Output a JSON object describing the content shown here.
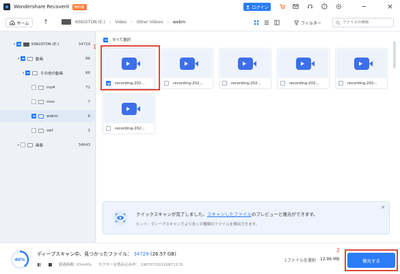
{
  "titlebar": {
    "app_name": "Wondershare Recoverit",
    "badge": "無料版",
    "login_label": "ログイン"
  },
  "toolbar_icons": [
    "cart-icon",
    "mail-icon",
    "headset-icon",
    "help-icon",
    "settings-icon",
    "minimize-icon",
    "close-icon"
  ],
  "nav": {
    "home_label": "ホーム",
    "breadcrumb": [
      "KINGSTON (E:)",
      "Video",
      "Other Videos",
      "webm"
    ],
    "filter_label": "フィルター",
    "search_placeholder": "ファイルの検索"
  },
  "tree": [
    {
      "label": "KINGSTON (E:)",
      "count": "34729"
    },
    {
      "label": "動画",
      "count": "86"
    },
    {
      "label": "その他の動画",
      "count": "86"
    },
    {
      "label": "mp4",
      "count": "72"
    },
    {
      "label": "mov",
      "count": "7"
    },
    {
      "label": "webm",
      "count": "6"
    },
    {
      "label": "swf",
      "count": "1"
    },
    {
      "label": "画像",
      "count": "34643"
    }
  ],
  "content": {
    "select_all_label": "すべて選択",
    "files": [
      {
        "name": "recording-202...",
        "checked": true
      },
      {
        "name": "recording-202...",
        "checked": false
      },
      {
        "name": "recording-202...",
        "checked": false
      },
      {
        "name": "recording-202...",
        "checked": false
      },
      {
        "name": "recording-202...",
        "checked": false
      },
      {
        "name": "recording-202...",
        "checked": false
      }
    ]
  },
  "annotations": {
    "marker1": "1",
    "marker2": "2",
    "color": "#e0453a"
  },
  "toast": {
    "text_before": "クイックスキャンが完了しました。",
    "link_text": "スキャンしたファイル",
    "text_after": "のプレビューと復元ができます。",
    "hint": "ヒント：ディープスキャンでより多くの種類のファイルを検出できます。"
  },
  "footer": {
    "progress": "40%",
    "progress_value": 0.4,
    "scan_prefix": "ディープスキャン中、見つかったファイル：",
    "scan_count": "34729",
    "scan_size": "(26.57 GB)",
    "elapsed": "経過時間: 03m40s",
    "sectors": "セクターを読み込み中： 19070720/120871170",
    "selected_files": "1ファイルを選択",
    "selected_size": "12.96 MB",
    "recover_label": "復元する"
  },
  "colors": {
    "accent": "#2b7cf6",
    "annotation": "#e0453a"
  }
}
